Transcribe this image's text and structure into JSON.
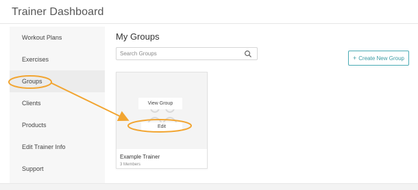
{
  "app": {
    "title": "Trainer Dashboard"
  },
  "sidebar": {
    "items": [
      {
        "label": "Workout Plans"
      },
      {
        "label": "Exercises"
      },
      {
        "label": "Groups",
        "active": true
      },
      {
        "label": "Clients"
      },
      {
        "label": "Products"
      },
      {
        "label": "Edit Trainer Info"
      },
      {
        "label": "Support"
      }
    ]
  },
  "main": {
    "title": "My Groups",
    "search": {
      "placeholder": "Search Groups",
      "value": ""
    },
    "create_button": "Create New Group"
  },
  "groups": [
    {
      "name": "Example Trainer",
      "members": "3 Members",
      "view_label": "View Group",
      "edit_label": "Edit"
    }
  ],
  "annotation": {
    "color": "#f2a531"
  },
  "colors": {
    "accent": "#48aab3"
  }
}
